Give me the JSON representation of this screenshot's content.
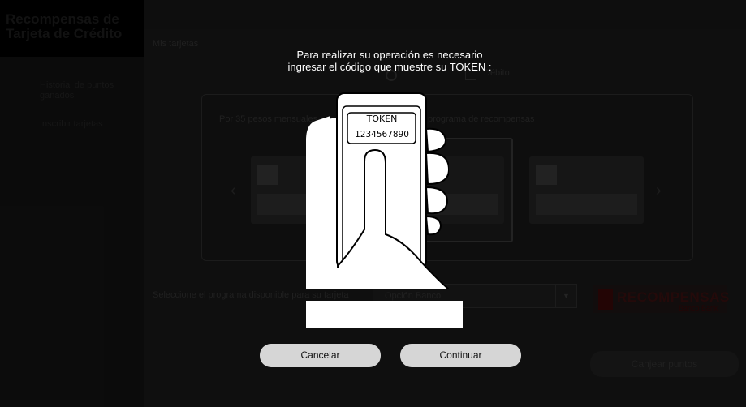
{
  "sidebar": {
    "title": "Recompensas de Tarjeta de Crédito",
    "items": [
      {
        "label": "Historial de puntos ganados"
      },
      {
        "label": "Inscribir tarjetas"
      }
    ]
  },
  "main": {
    "section_title": "Mis tarjetas",
    "radio_option": "Débito",
    "carousel": {
      "text_left": "Por 35 pesos mensuales",
      "text_right": "programa de recompensas"
    },
    "program_label": "Seleccione el programa disponible para su tarjeta",
    "program_select_value": "Opción Banco",
    "brand_logo_word": "RECOMPENSAS",
    "brand_logo_sub": "Banco Bank",
    "redeem_button": "Canjear puntos"
  },
  "modal": {
    "message_line1": "Para realizar su operación es necesario",
    "message_line2": "ingresar el código que muestre su  TOKEN :",
    "token_label": "TOKEN",
    "token_code": "1234567890",
    "input_value": "",
    "cancel_label": "Cancelar",
    "continue_label": "Continuar"
  },
  "colors": {
    "modal_button_bg": "#d6d6d6",
    "window_titlebar": "#5573b0",
    "brand_red": "#2b0c0c"
  }
}
